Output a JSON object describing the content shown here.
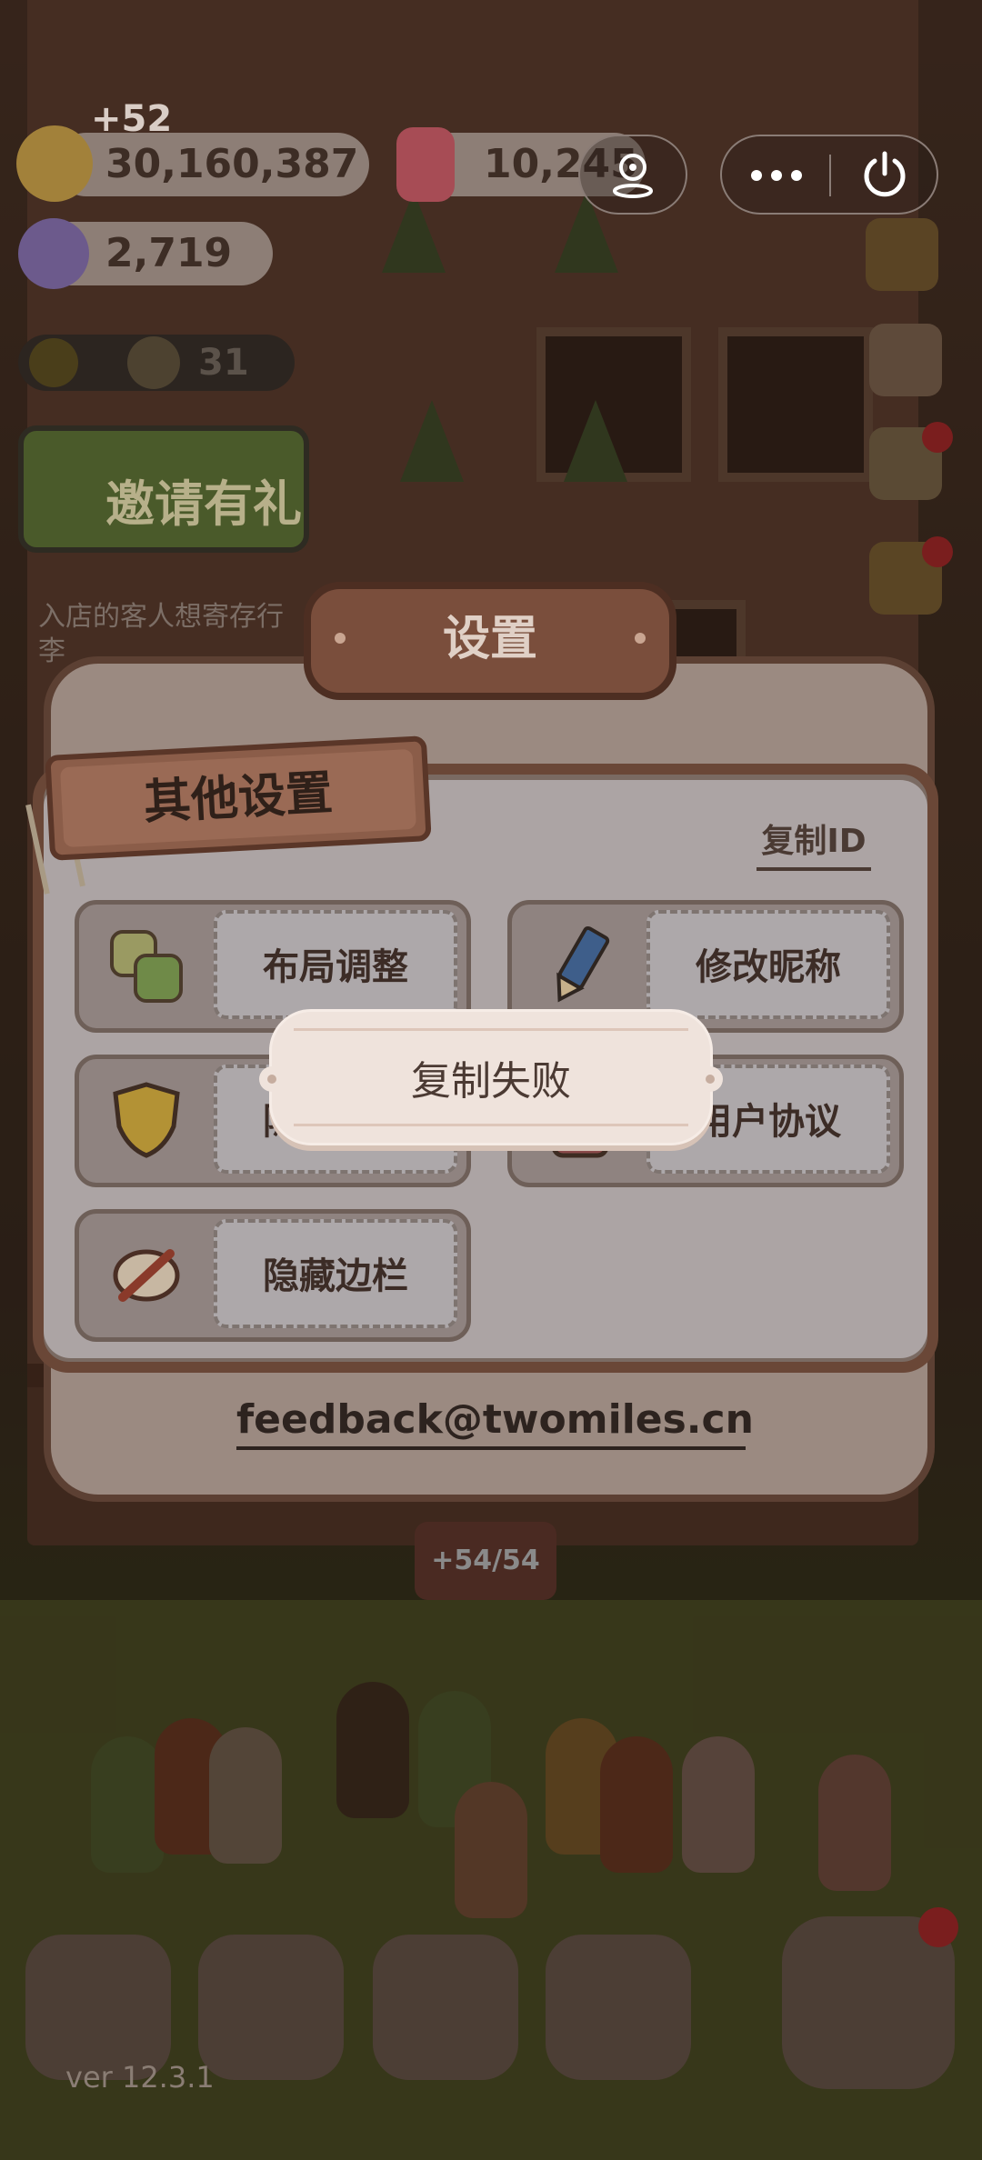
{
  "hud": {
    "gain_text": "+52",
    "coins": "30,160,387",
    "candles": "10,245",
    "candy": "2,719",
    "helpers": "31",
    "invite_label": "邀请有礼",
    "guest_message": "入店的客人想寄存行李",
    "energy": "+54/54"
  },
  "capsule": {
    "more_icon": "ellipsis-icon",
    "close_icon": "power-icon",
    "location_icon": "location-pin-icon"
  },
  "settings": {
    "title": "设置",
    "section_tag": "其他设置",
    "copy_id": "复制ID",
    "options": [
      {
        "label": "布局调整",
        "icon": "layout-blocks-icon"
      },
      {
        "label": "修改昵称",
        "icon": "pencil-icon"
      },
      {
        "label": "隐私政策",
        "icon": "shield-icon"
      },
      {
        "label": "用户协议",
        "icon": "document-icon"
      },
      {
        "label": "隐藏边栏",
        "icon": "hide-eye-icon"
      }
    ],
    "feedback_email": "feedback@twomiles.cn"
  },
  "toast": {
    "message": "复制失败"
  },
  "footer": {
    "version": "ver 12.3.1"
  },
  "colors": {
    "panel_border": "#5c4033",
    "toast_bg": "#efe3dc",
    "accent_gold": "#c9a23a"
  }
}
